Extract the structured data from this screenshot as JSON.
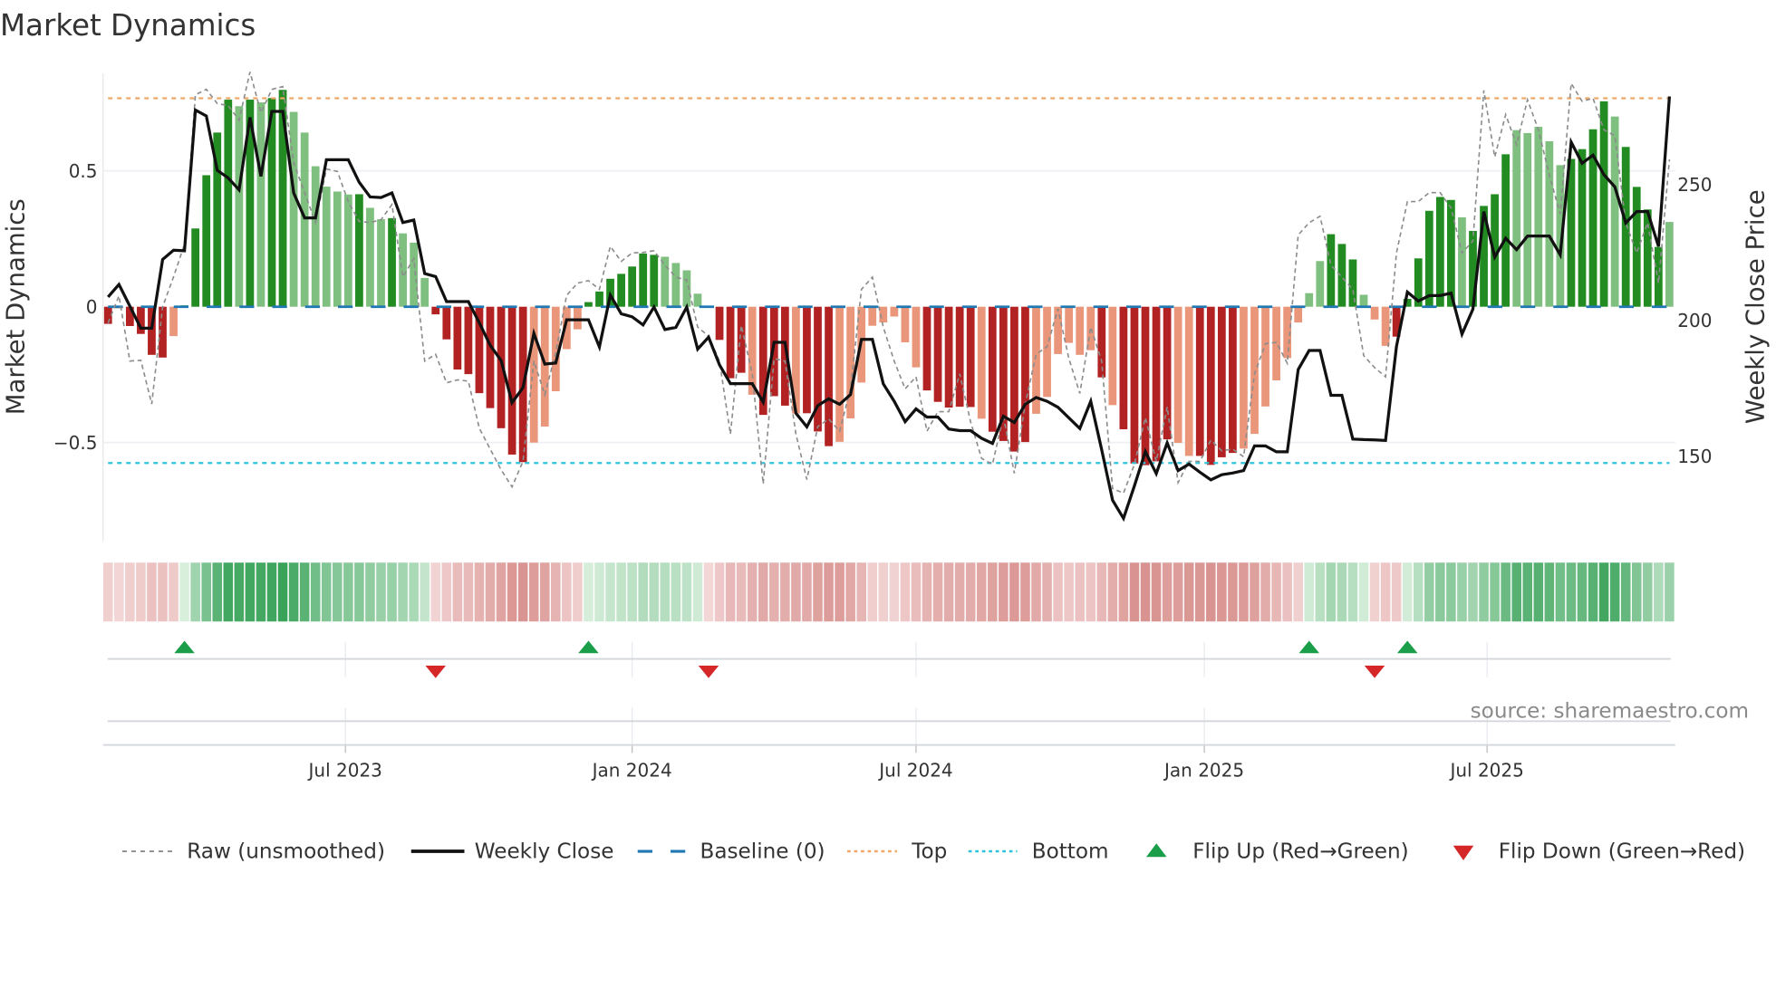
{
  "chart_data": {
    "type": "bar",
    "title": "Market Dynamics",
    "ylabel": "Market Dynamics",
    "y2label": "Weekly Close Price",
    "source": "source: sharemaestro.com",
    "ylim": [
      -0.8625,
      0.858
    ],
    "y2lim": [
      118.75,
      290.8
    ],
    "yticks": [
      {
        "v": 0.5,
        "label": "0.5"
      },
      {
        "v": 0,
        "label": "0"
      },
      {
        "v": -0.5,
        "label": "−0.5"
      }
    ],
    "y2ticks": [
      {
        "v": 250,
        "label": "250"
      },
      {
        "v": 200,
        "label": "200"
      },
      {
        "v": 150,
        "label": "150"
      }
    ],
    "xticks": [
      {
        "week": 21.74,
        "label": "Jul 2023"
      },
      {
        "week": 48.0,
        "label": "Jan 2024"
      },
      {
        "week": 74.0,
        "label": "Jul 2024"
      },
      {
        "week": 100.4,
        "label": "Jan 2025"
      },
      {
        "week": 126.3,
        "label": "Jul 2025"
      }
    ],
    "baseline": 0,
    "top": 0.767,
    "bottom": -0.575,
    "colors": {
      "dark_green": "#228b22",
      "light_green": "#7fbf7f",
      "dark_red": "#b22222",
      "light_red": "#e9967a",
      "close": "#111111",
      "raw": "#8c8c8c",
      "baseline": "#1f77b4",
      "top": "#f0a868",
      "bottom": "#2ec4dc",
      "flip_up": "#1a9e4a",
      "flip_down": "#d62728"
    },
    "momentum": [
      -0.063,
      -0.005,
      -0.071,
      -0.1,
      -0.177,
      -0.187,
      -0.108,
      0.005,
      0.288,
      0.484,
      0.641,
      0.762,
      0.738,
      0.762,
      0.752,
      0.768,
      0.798,
      0.717,
      0.641,
      0.517,
      0.442,
      0.424,
      0.413,
      0.414,
      0.364,
      0.322,
      0.326,
      0.27,
      0.236,
      0.106,
      -0.028,
      -0.12,
      -0.231,
      -0.248,
      -0.318,
      -0.373,
      -0.447,
      -0.544,
      -0.572,
      -0.5,
      -0.441,
      -0.311,
      -0.156,
      -0.083,
      0.017,
      0.056,
      0.103,
      0.121,
      0.148,
      0.196,
      0.191,
      0.184,
      0.161,
      0.134,
      0.048,
      -0.004,
      -0.122,
      -0.263,
      -0.243,
      -0.324,
      -0.398,
      -0.329,
      -0.364,
      -0.393,
      -0.392,
      -0.459,
      -0.513,
      -0.497,
      -0.411,
      -0.279,
      -0.07,
      -0.058,
      -0.036,
      -0.131,
      -0.223,
      -0.308,
      -0.35,
      -0.371,
      -0.368,
      -0.369,
      -0.412,
      -0.46,
      -0.494,
      -0.533,
      -0.498,
      -0.394,
      -0.332,
      -0.174,
      -0.133,
      -0.177,
      -0.16,
      -0.26,
      -0.362,
      -0.451,
      -0.577,
      -0.583,
      -0.569,
      -0.488,
      -0.501,
      -0.549,
      -0.549,
      -0.582,
      -0.554,
      -0.538,
      -0.522,
      -0.468,
      -0.367,
      -0.271,
      -0.189,
      -0.058,
      0.05,
      0.168,
      0.267,
      0.231,
      0.174,
      0.044,
      -0.047,
      -0.144,
      -0.11,
      0.029,
      0.178,
      0.353,
      0.404,
      0.393,
      0.329,
      0.279,
      0.371,
      0.414,
      0.561,
      0.65,
      0.639,
      0.662,
      0.609,
      0.521,
      0.544,
      0.58,
      0.653,
      0.756,
      0.7,
      0.588,
      0.441,
      0.358,
      0.22,
      0.312
    ],
    "shade": "ddddddldddddldlddlllllldlldllldddddddddllllldddddddllllldddldddldddlllllllldddddlddddlllllldldddddllddddlllllllldddlllddddddlddddlllllddddlddddllllld",
    "raw": [
      -0.06,
      0.04,
      -0.2,
      -0.197,
      -0.358,
      0,
      0.11,
      0.23,
      0.78,
      0.8,
      0.748,
      0.74,
      0.687,
      0.864,
      0.714,
      0.8,
      0.81,
      0.53,
      0.42,
      0.31,
      0.507,
      0.498,
      0.387,
      0.314,
      0.31,
      0.32,
      0.376,
      0.11,
      0.177,
      -0.2,
      -0.175,
      -0.28,
      -0.269,
      -0.274,
      -0.447,
      -0.524,
      -0.6,
      -0.663,
      -0.569,
      -0.2,
      -0.324,
      -0.169,
      0.042,
      0.087,
      0.096,
      0.064,
      0.222,
      0.167,
      0.198,
      0.2,
      0.206,
      0.153,
      0.109,
      0.098,
      -0.075,
      -0.108,
      -0.2,
      -0.469,
      -0.069,
      -0.247,
      -0.652,
      -0.191,
      -0.2,
      -0.469,
      -0.636,
      -0.441,
      -0.413,
      -0.458,
      -0.302,
      0.064,
      0.109,
      -0.075,
      -0.2,
      -0.302,
      -0.258,
      -0.458,
      -0.386,
      -0.386,
      -0.247,
      -0.424,
      -0.558,
      -0.58,
      -0.402,
      -0.613,
      -0.358,
      -0.175,
      -0.147,
      -0.008,
      -0.191,
      -0.319,
      -0.075,
      -0.2,
      -0.669,
      -0.686,
      -0.58,
      -0.408,
      -0.569,
      -0.369,
      -0.647,
      -0.569,
      -0.569,
      -0.491,
      -0.53,
      -0.524,
      -0.552,
      -0.247,
      -0.136,
      -0.131,
      -0.208,
      0.264,
      0.309,
      0.333,
      0.153,
      0.109,
      0.064,
      -0.18,
      -0.224,
      -0.258,
      0.198,
      0.387,
      0.387,
      0.42,
      0.42,
      0.364,
      0.198,
      0.242,
      0.796,
      0.551,
      0.707,
      0.596,
      0.762,
      0.651,
      0.484,
      0.342,
      0.822,
      0.756,
      0.767,
      0.651,
      0.629,
      0.309,
      0.198,
      0.309,
      0.087,
      0.542
    ],
    "close": [
      208.6,
      213.2,
      205.2,
      197.1,
      197.1,
      222.4,
      225.8,
      225.6,
      277.4,
      275.2,
      255.2,
      252.4,
      248,
      274.7,
      253,
      276.9,
      276.9,
      246.9,
      237.7,
      237.7,
      259.1,
      259.1,
      259.1,
      250.8,
      245.4,
      245.2,
      246.9,
      236,
      236.9,
      217.2,
      216.1,
      206.9,
      206.9,
      206.9,
      199.1,
      190.8,
      185.2,
      169.7,
      175.2,
      195.2,
      183.9,
      184.3,
      200.2,
      200.2,
      200.2,
      190.2,
      209.3,
      202.4,
      201.3,
      198.3,
      204.9,
      196.6,
      197.4,
      204.9,
      189.4,
      193.8,
      183.6,
      176.7,
      176.7,
      176.7,
      169.9,
      191.9,
      191.9,
      165.8,
      160.8,
      168.6,
      171.1,
      169.1,
      172.7,
      193,
      193,
      176.6,
      170.2,
      162.7,
      167.4,
      164.4,
      164.4,
      160,
      159.4,
      159.4,
      156.6,
      154.7,
      164.7,
      162.4,
      169.1,
      171.6,
      170.2,
      168,
      164.1,
      160.2,
      170.2,
      152.4,
      133.8,
      127.1,
      139.1,
      151.7,
      143.6,
      154.9,
      144.7,
      147.1,
      144.1,
      141.3,
      143.2,
      143.8,
      144.7,
      153.8,
      153.8,
      151.6,
      151.6,
      181.9,
      188.9,
      188.9,
      172.4,
      172.4,
      156.3,
      156.1,
      156,
      155.8,
      190.4,
      210.4,
      207.1,
      209.1,
      209.1,
      210,
      194.9,
      204.1,
      240,
      223.3,
      230.2,
      226,
      231,
      231,
      231,
      224.1,
      265.6,
      257.8,
      260.8,
      253.6,
      249.1,
      235.8,
      240,
      240,
      227.2,
      282.4
    ],
    "flip_up_weeks": [
      7,
      44,
      110,
      119
    ],
    "flip_down_weeks": [
      30,
      55,
      116
    ],
    "legend": {
      "raw": "Raw (unsmoothed)",
      "close": "Weekly Close",
      "baseline": "Baseline (0)",
      "top": "Top",
      "bottom": "Bottom",
      "flip_up": "Flip Up (Red→Green)",
      "flip_down": "Flip Down (Green→Red)"
    }
  }
}
